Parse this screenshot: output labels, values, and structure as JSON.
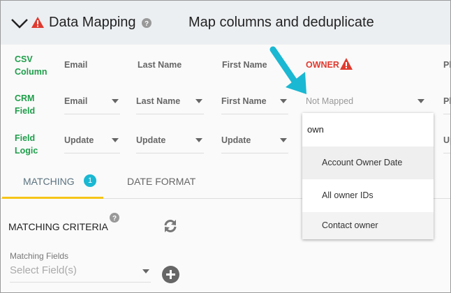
{
  "header": {
    "title": "Data Mapping",
    "subtitle": "Map columns and deduplicate"
  },
  "row_labels": {
    "csv": "CSV Column",
    "crm": "CRM Field",
    "logic": "Field Logic"
  },
  "csv_columns": [
    "Email",
    "Last Name",
    "First Name",
    "OWNER",
    "Ph"
  ],
  "crm_fields": [
    "Email",
    "Last Name",
    "First Name",
    "Not Mapped",
    "Ph"
  ],
  "field_logic": [
    "Update",
    "Update",
    "Update",
    "Up"
  ],
  "dropdown": {
    "search": "own",
    "options": [
      "Account Owner Date",
      "All owner IDs",
      "Contact owner"
    ]
  },
  "tabs": [
    {
      "label": "MATCHING",
      "badge": "1",
      "active": true
    },
    {
      "label": "DATE FORMAT"
    }
  ],
  "matching": {
    "title": "MATCHING CRITERIA",
    "fields_label": "Matching Fields",
    "placeholder": "Select Field(s)"
  },
  "colors": {
    "green": "#1e9e4a",
    "error": "#e03a2f",
    "accent": "#1ab8d2",
    "tab_underline": "#f5c518"
  }
}
